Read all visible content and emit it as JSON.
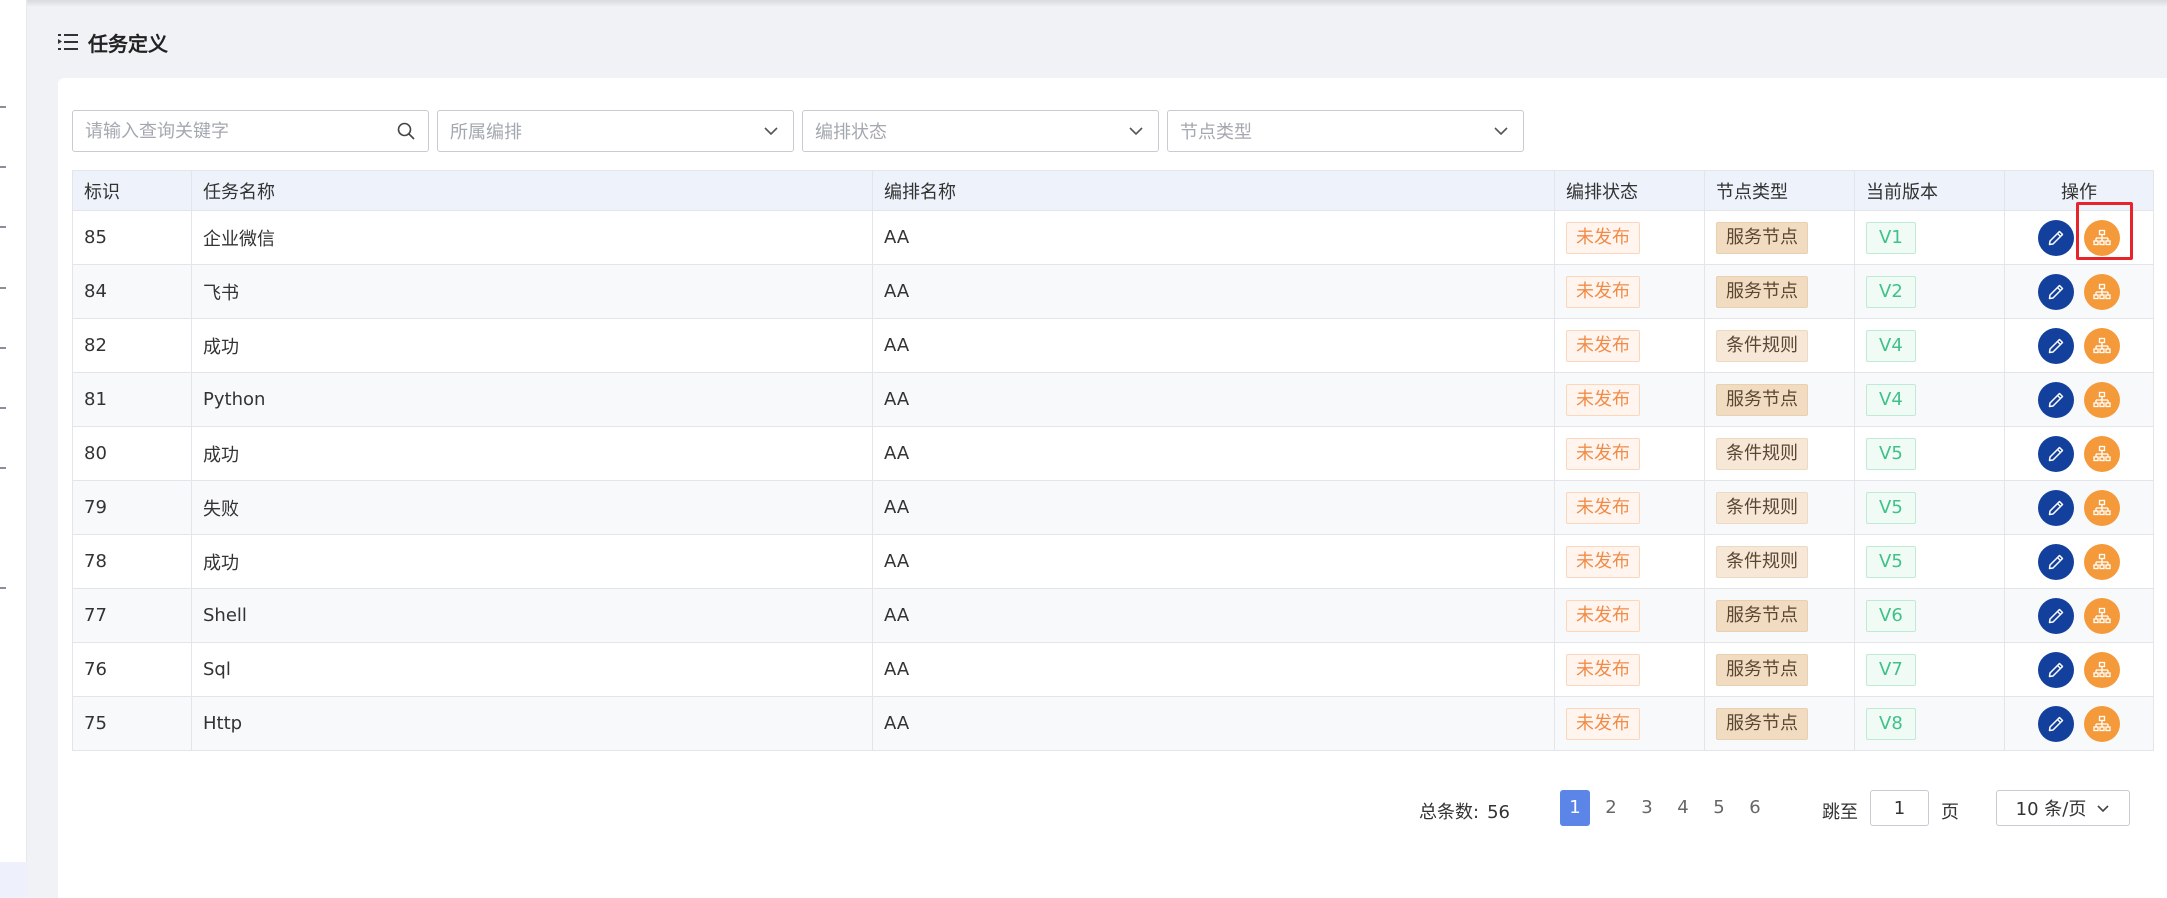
{
  "page": {
    "title": "任务定义"
  },
  "filters": {
    "search_placeholder": "请输入查询关键字",
    "orchestration_placeholder": "所属编排",
    "status_placeholder": "编排状态",
    "node_type_placeholder": "节点类型"
  },
  "table": {
    "headers": [
      "标识",
      "任务名称",
      "编排名称",
      "编排状态",
      "节点类型",
      "当前版本",
      "操作"
    ],
    "rows": [
      {
        "id": "85",
        "name": "企业微信",
        "orch": "AA",
        "status": "未发布",
        "node": "服务节点",
        "ver": "V1"
      },
      {
        "id": "84",
        "name": "飞书",
        "orch": "AA",
        "status": "未发布",
        "node": "服务节点",
        "ver": "V2"
      },
      {
        "id": "82",
        "name": "成功",
        "orch": "AA",
        "status": "未发布",
        "node": "条件规则",
        "ver": "V4"
      },
      {
        "id": "81",
        "name": "Python",
        "orch": "AA",
        "status": "未发布",
        "node": "服务节点",
        "ver": "V4"
      },
      {
        "id": "80",
        "name": "成功",
        "orch": "AA",
        "status": "未发布",
        "node": "条件规则",
        "ver": "V5"
      },
      {
        "id": "79",
        "name": "失败",
        "orch": "AA",
        "status": "未发布",
        "node": "条件规则",
        "ver": "V5"
      },
      {
        "id": "78",
        "name": "成功",
        "orch": "AA",
        "status": "未发布",
        "node": "条件规则",
        "ver": "V5"
      },
      {
        "id": "77",
        "name": "Shell",
        "orch": "AA",
        "status": "未发布",
        "node": "服务节点",
        "ver": "V6"
      },
      {
        "id": "76",
        "name": "Sql",
        "orch": "AA",
        "status": "未发布",
        "node": "服务节点",
        "ver": "V7"
      },
      {
        "id": "75",
        "name": "Http",
        "orch": "AA",
        "status": "未发布",
        "node": "服务节点",
        "ver": "V8"
      }
    ]
  },
  "pagination": {
    "total_label": "总条数:",
    "total": "56",
    "pages": [
      "1",
      "2",
      "3",
      "4",
      "5",
      "6"
    ],
    "current_page": "1",
    "jump_label": "跳至",
    "jump_value": "1",
    "page_label": "页",
    "page_size": "10 条/页"
  },
  "icons": {
    "menu": "indent-list-icon",
    "search": "search-icon",
    "dropdown": "chevron-down-icon",
    "edit": "pencil-icon",
    "flow": "org-chart-icon"
  },
  "colors": {
    "accent": "#5b85e6",
    "edit_button": "#12409c",
    "flow_button": "#f59a3a",
    "highlight": "#e8242b",
    "unpublished": "#f08c49",
    "version": "#3fc188"
  }
}
